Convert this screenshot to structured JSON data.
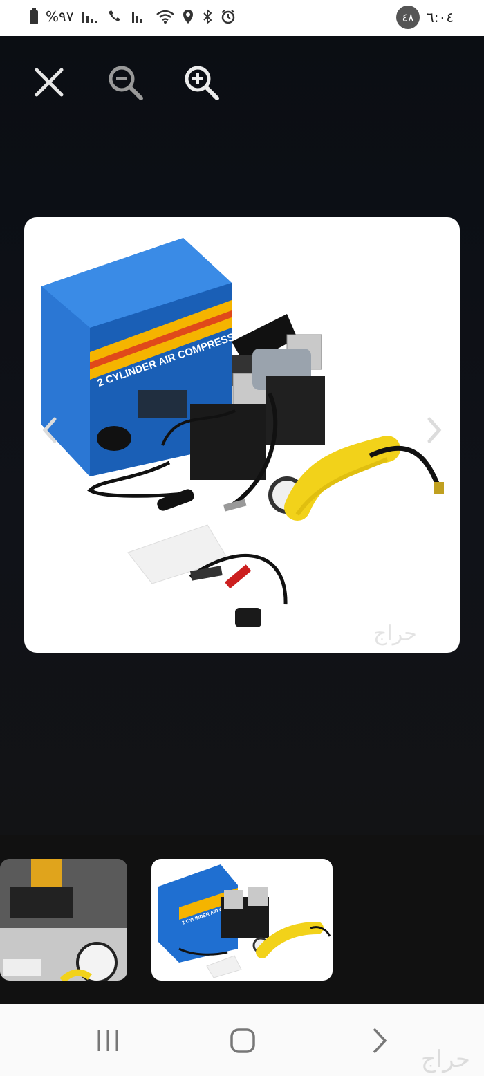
{
  "status_bar": {
    "battery_text": "%٩٧",
    "time": "٦:٠٤",
    "notification_count": "٤٨"
  },
  "viewer": {
    "image": {
      "box_headline": "2 CYLINDER AIR COMPRESSOR",
      "watermark": "حراج"
    }
  },
  "thumbnails": [
    {
      "label": "",
      "selected": false
    },
    {
      "label": "2 CYLINDER AIR COMPRESSOR",
      "selected": true
    }
  ],
  "nav": {
    "watermark": "حراج"
  },
  "colors": {
    "viewer_bg": "#121212",
    "card_bg": "#ffffff",
    "status_bar_bg": "#ffffff",
    "nav_bar_bg": "#fafafa",
    "box_blue": "#1f6fd1",
    "hose_yellow": "#f2d21a"
  },
  "icons": {
    "close": "close-icon",
    "zoom_out": "zoom-out-icon",
    "zoom_in": "zoom-in-icon",
    "prev": "chevron-left-icon",
    "next": "chevron-right-icon"
  }
}
